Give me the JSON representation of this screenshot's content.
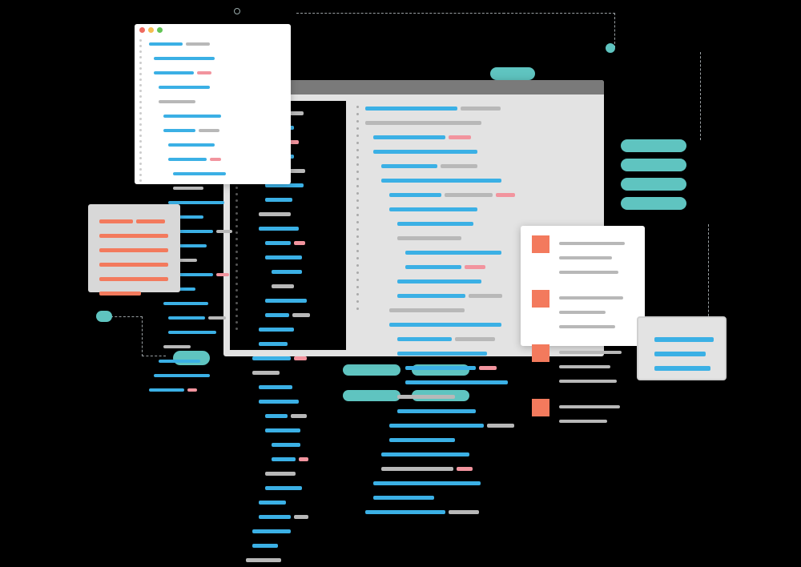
{
  "description": "Decorative illustration of abstract code editor windows, snippets, and UI cards with colored bars representing text. No readable text content.",
  "palette": {
    "blue": "#3bb0e5",
    "gray": "#b8b8b8",
    "pink": "#f2949e",
    "orange": "#f37a5d",
    "teal": "#5fc4c0",
    "dark": "#000000",
    "panel": "#e3e3e3"
  }
}
